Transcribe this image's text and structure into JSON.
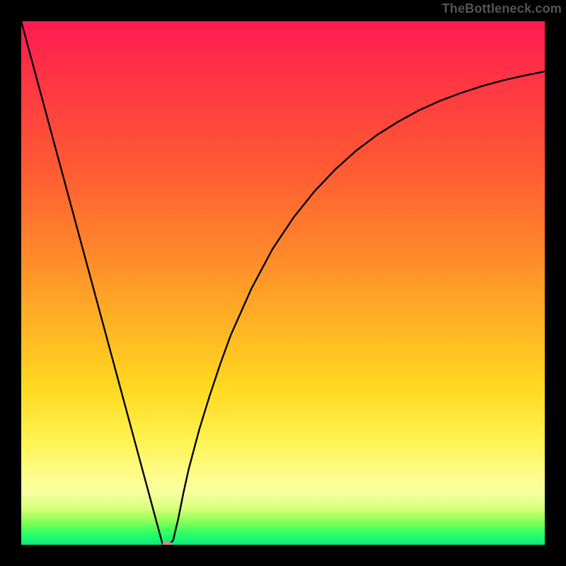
{
  "watermark": "TheBottleneck.com",
  "colors": {
    "frame": "#000000",
    "curve": "#000000",
    "marker": "#cf8f86",
    "gradient_top": "#ff1a52",
    "gradient_bottom": "#14e27d"
  },
  "chart_data": {
    "type": "line",
    "title": "",
    "xlabel": "",
    "ylabel": "",
    "xlim": [
      0,
      100
    ],
    "ylim": [
      0,
      100
    ],
    "x": [
      0,
      2,
      4,
      6,
      8,
      10,
      12,
      14,
      16,
      18,
      20,
      22,
      24,
      26,
      27,
      28,
      29,
      30,
      31,
      32,
      34,
      36,
      38,
      40,
      44,
      48,
      52,
      56,
      60,
      64,
      68,
      72,
      76,
      80,
      84,
      88,
      92,
      96,
      100
    ],
    "y": [
      100,
      92.6,
      85.2,
      77.8,
      70.4,
      63.0,
      55.6,
      48.2,
      40.8,
      33.4,
      26.0,
      18.6,
      11.2,
      3.8,
      0.1,
      0.0,
      0.8,
      5.0,
      10.0,
      14.5,
      22.0,
      28.5,
      34.5,
      40.0,
      49.0,
      56.5,
      62.5,
      67.5,
      71.7,
      75.3,
      78.3,
      80.8,
      83.0,
      84.8,
      86.3,
      87.6,
      88.7,
      89.6,
      90.4
    ],
    "marker": {
      "x": 27.8,
      "y": 0.0
    }
  }
}
